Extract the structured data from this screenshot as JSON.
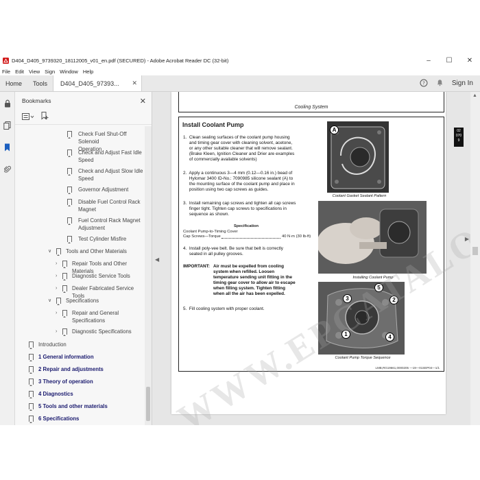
{
  "window": {
    "title": "D404_D405_9739320_18112005_v01_en.pdf (SECURED) - Adobe Acrobat Reader DC (32-bit)"
  },
  "menu": [
    "File",
    "Edit",
    "View",
    "Sign",
    "Window",
    "Help"
  ],
  "tabs": {
    "home": "Home",
    "tools": "Tools",
    "doc": "D404_D405_97393...",
    "signin": "Sign In"
  },
  "bookmarks": {
    "title": "Bookmarks",
    "items": [
      {
        "label": "Check Fuel Shut-Off Solenoid Operation",
        "line1": "Check Fuel Shut-Off Solenoid",
        "line2": "Operation"
      },
      {
        "label": "Check and Adjust Fast Idle Speed",
        "line1": "Check and Adjust Fast Idle",
        "line2": "Speed"
      },
      {
        "label": "Check and Adjust Slow Idle Speed",
        "line1": "Check and Adjust Slow Idle",
        "line2": "Speed"
      },
      {
        "label": "Governor Adjustment",
        "line1": "Governor Adjustment",
        "line2": ""
      },
      {
        "label": "Disable Fuel Control Rack Magnet",
        "line1": "Disable Fuel Control Rack",
        "line2": "Magnet"
      },
      {
        "label": "Fuel Control Rack Magnet Adjustment",
        "line1": "Fuel Control Rack Magnet",
        "line2": "Adjustment"
      },
      {
        "label": "Test Cylinder Misfire",
        "line1": "Test Cylinder Misfire",
        "line2": ""
      },
      {
        "label": "Tools and Other Materials",
        "line1": "Tools and Other Materials",
        "line2": ""
      },
      {
        "label": "Repair Tools and Other Materials",
        "line1": "Repair Tools and Other Materials",
        "line2": ""
      },
      {
        "label": "Diagnostic Service Tools",
        "line1": "Diagnostic Service Tools",
        "line2": ""
      },
      {
        "label": "Dealer Fabricated Service Tools",
        "line1": "Dealer Fabricated Service Tools",
        "line2": ""
      },
      {
        "label": "Specifications",
        "line1": "Specifications",
        "line2": ""
      },
      {
        "label": "Repair and General Specifications",
        "line1": "Repair and General",
        "line2": "Specifications"
      },
      {
        "label": "Diagnostic Specifications",
        "line1": "Diagnostic Specifications",
        "line2": ""
      },
      {
        "label": "Introduction",
        "line1": "Introduction",
        "line2": ""
      },
      {
        "label": "1 General information",
        "line1": "1 General information",
        "line2": ""
      },
      {
        "label": "2 Repair and adjustments",
        "line1": "2 Repair and adjustments",
        "line2": ""
      },
      {
        "label": "3 Theory of operation",
        "line1": "3 Theory of operation",
        "line2": ""
      },
      {
        "label": "4 Diagnostics",
        "line1": "4 Diagnostics",
        "line2": ""
      },
      {
        "label": "5 Tools and other materials",
        "line1": "5 Tools and other materials",
        "line2": ""
      },
      {
        "label": "6 Specifications",
        "line1": "6 Specifications",
        "line2": ""
      }
    ]
  },
  "page": {
    "header": "Cooling System",
    "section_title": "Install Coolant Pump",
    "steps": [
      "1.  Clean sealing surfaces of the coolant pump housing\n     and timing gear cover with cleaning solvent, acetone,\n     or any other suitable cleaner that will remove sealant.\n     (Brake Kleen, Ignition Cleaner and Drier are examples\n     of commercially available solvents)",
      "2.  Apply a continuous 3—4 mm (0.12—0.16 in.) bead of\n     Hylomar 3400 ID-No.: 7090985 silicone sealant (A) to\n     the mounting surface of the coolant pump and place in\n     position using two cap screws as guides.",
      "3.  Install remaining cap screws and tighten all cap screws\n     finger tight. Tighten cap screws to specifications in\n     sequence as shown.",
      "4.  Install poly-vee belt. Be sure that belt is correctly\n     seated in all pulley grooves.",
      "5.  Fill cooling system with proper coolant."
    ],
    "spec_title": "Specification",
    "spec_line1": "Coolant Pump-to-Timing Cover",
    "spec_line2_left": "Cap Screws—Torque",
    "spec_line2_right": "40 N·m (30 lb-ft)",
    "important_label": "IMPORTANT:",
    "important_text": "Air must be expelled from cooling\nsystem when refilled. Loosen\ntemperature sending unit fitting in the\ntiming gear cover to allow air to escape\nwhen filling system. Tighten fitting\nwhen all the air has been expelled.",
    "fig1_caption": "Coolant Gasket Sealant Pattern",
    "fig2_caption": "Installing Coolant Pump",
    "fig3_caption": "Coolant Pump Torque Sequence",
    "side_tab": "02\n070\n9",
    "footer": "LMB,RG19661,0000205   —19—01SEP04—1/1",
    "watermark": "WWW.EPCATALOG.COM",
    "callout_a": "A",
    "callouts": [
      "1",
      "2",
      "3",
      "4",
      "5"
    ]
  }
}
